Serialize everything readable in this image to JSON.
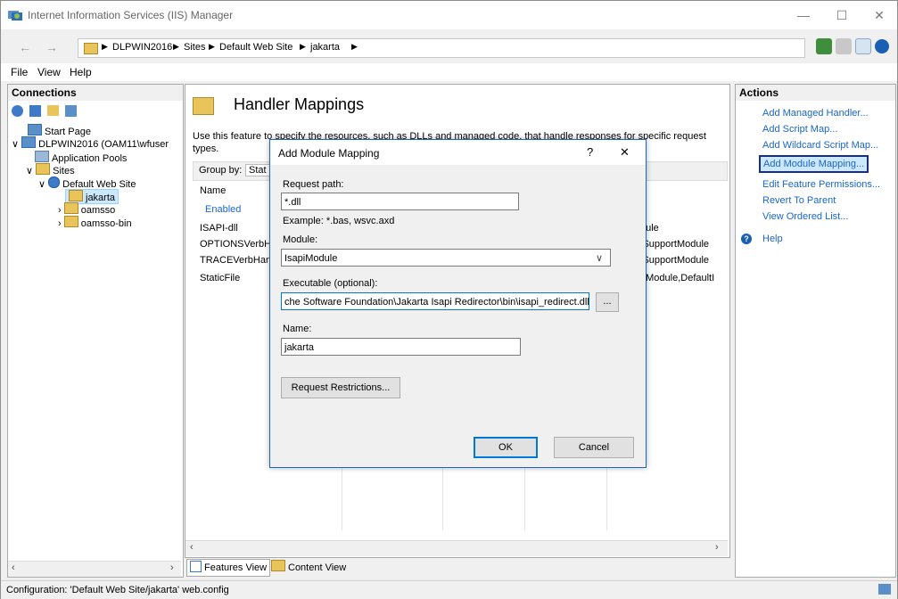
{
  "window": {
    "title": "Internet Information Services (IIS) Manager"
  },
  "breadcrumbs": [
    "DLPWIN2016",
    "Sites",
    "Default Web Site",
    "jakarta"
  ],
  "menu": [
    "File",
    "View",
    "Help"
  ],
  "connections": {
    "header": "Connections",
    "tree": [
      {
        "label": "Start Page"
      },
      {
        "label": "DLPWIN2016 (OAM11\\wfuser"
      },
      {
        "label": "Application Pools"
      },
      {
        "label": "Sites"
      },
      {
        "label": "Default Web Site"
      },
      {
        "label": "jakarta"
      },
      {
        "label": "oamsso"
      },
      {
        "label": "oamsso-bin"
      }
    ]
  },
  "center": {
    "title": "Handler Mappings",
    "desc_line1": "Use this feature to specify the resources, such as DLLs and managed code, that handle responses for specific request",
    "desc_line2": "types.",
    "groupby_label": "Group by:",
    "groupby_value": "Stat",
    "col_name": "Name",
    "group_enabled": "Enabled",
    "rows": [
      {
        "name": "ISAPI-dll",
        "handler": "dule"
      },
      {
        "name": "OPTIONSVerbHa",
        "handler": "lSupportModule"
      },
      {
        "name": "TRACEVerbHanc",
        "handler": "lSupportModule"
      },
      {
        "name": "StaticFile",
        "handler": "eModule,DefaultI"
      }
    ],
    "features_view": "Features View",
    "content_view": "Content View"
  },
  "actions": {
    "header": "Actions",
    "items": [
      "Add Managed Handler...",
      "Add Script Map...",
      "Add Wildcard Script Map...",
      "Add Module Mapping...",
      "Edit Feature Permissions...",
      "Revert To Parent",
      "View Ordered List..."
    ],
    "help": "Help"
  },
  "dialog": {
    "title": "Add Module Mapping",
    "help_glyph": "?",
    "close_glyph": "✕",
    "request_path_label": "Request path:",
    "request_path_value": "*.dll",
    "example": "Example: *.bas, wsvc.axd",
    "module_label": "Module:",
    "module_value": "IsapiModule",
    "executable_label": "Executable (optional):",
    "executable_value": "che Software Foundation\\Jakarta Isapi Redirector\\bin\\isapi_redirect.dll",
    "browse": "...",
    "name_label": "Name:",
    "name_value": "jakarta",
    "restrictions": "Request Restrictions...",
    "ok": "OK",
    "cancel": "Cancel"
  },
  "status": "Configuration: 'Default Web Site/jakarta' web.config"
}
